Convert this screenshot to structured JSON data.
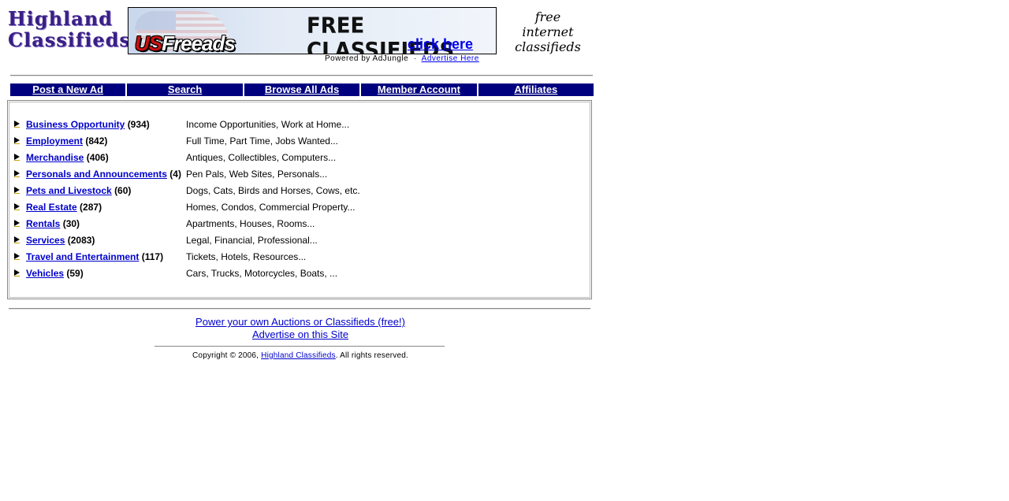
{
  "header": {
    "logo_line1": "Highland",
    "logo_line2": "Classifieds",
    "banner": {
      "brand_prefix": "US",
      "brand_suffix": "Freeads",
      "headline": "FREE CLASSIFIEDS",
      "cta": "click here"
    },
    "powered_by": "Powered by AdJungle",
    "separator": "·",
    "advertise_link": "Advertise Here",
    "tagline_line1": "free",
    "tagline_line2": "internet",
    "tagline_line3": "classifieds"
  },
  "nav": {
    "items": [
      {
        "label": "Post a New Ad"
      },
      {
        "label": "Search"
      },
      {
        "label": "Browse All Ads"
      },
      {
        "label": "Member Account"
      },
      {
        "label": "Affiliates"
      }
    ]
  },
  "categories": [
    {
      "name": "Business Opportunity",
      "count": "(934)",
      "desc": "Income Opportunities, Work at Home..."
    },
    {
      "name": "Employment",
      "count": "(842)",
      "desc": "Full Time, Part Time, Jobs Wanted..."
    },
    {
      "name": "Merchandise",
      "count": "(406)",
      "desc": "Antiques, Collectibles, Computers..."
    },
    {
      "name": "Personals and Announcements",
      "count": "(4)",
      "desc": "Pen Pals, Web Sites, Personals..."
    },
    {
      "name": "Pets and Livestock",
      "count": "(60)",
      "desc": "Dogs, Cats, Birds and Horses, Cows, etc."
    },
    {
      "name": "Real Estate",
      "count": "(287)",
      "desc": "Homes, Condos, Commercial Property..."
    },
    {
      "name": "Rentals",
      "count": "(30)",
      "desc": "Apartments, Houses, Rooms..."
    },
    {
      "name": "Services",
      "count": "(2083)",
      "desc": "Legal, Financial, Professional..."
    },
    {
      "name": "Travel and Entertainment",
      "count": "(117)",
      "desc": "Tickets, Hotels, Resources..."
    },
    {
      "name": "Vehicles",
      "count": "(59)",
      "desc": "Cars, Trucks, Motorcycles, Boats, ..."
    }
  ],
  "footer": {
    "link1": "Power your own Auctions or Classifieds (free!)",
    "link2": "Advertise on this Site",
    "copyright_prefix": "Copyright © 2006,",
    "copyright_link": "Highland Classifieds",
    "copyright_suffix": ". All rights reserved."
  },
  "colors": {
    "nav_bg": "#00007f",
    "link": "#0000cc",
    "logo": "#3a1f86"
  }
}
